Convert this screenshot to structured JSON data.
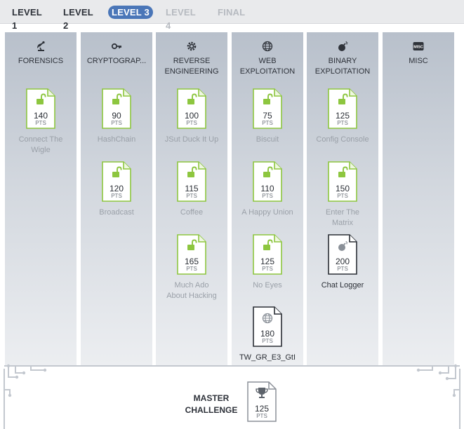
{
  "tabs": [
    {
      "label": "LEVEL 1",
      "state": "normal"
    },
    {
      "label": "LEVEL 2",
      "state": "normal"
    },
    {
      "label": "LEVEL 3",
      "state": "active"
    },
    {
      "label": "LEVEL 4",
      "state": "locked"
    },
    {
      "label": "FINAL",
      "state": "locked"
    }
  ],
  "colors": {
    "accent": "#4a76b8",
    "solved_green": "#8dc63f",
    "unlocked_outline": "#2a2e35",
    "column_top": "#b8c0cb"
  },
  "categories": [
    {
      "title": "FORENSICS",
      "icon": "satellite-dish-icon",
      "challenges": [
        {
          "name": "Connect The\nWigle",
          "points": "140",
          "unit": "PTS",
          "status": "solved"
        }
      ]
    },
    {
      "title": "CRYPTOGRAP...",
      "icon": "key-icon",
      "challenges": [
        {
          "name": "HashChain",
          "points": "90",
          "unit": "PTS",
          "status": "solved"
        },
        {
          "name": "Broadcast",
          "points": "120",
          "unit": "PTS",
          "status": "solved"
        }
      ]
    },
    {
      "title": "REVERSE\nENGINEERING",
      "icon": "gear-icon",
      "challenges": [
        {
          "name": "JSut Duck It Up",
          "points": "100",
          "unit": "PTS",
          "status": "solved"
        },
        {
          "name": "Coffee",
          "points": "115",
          "unit": "PTS",
          "status": "solved"
        },
        {
          "name": "Much Ado\nAbout Hacking",
          "points": "165",
          "unit": "PTS",
          "status": "solved"
        }
      ]
    },
    {
      "title": "WEB\nEXPLOITATION",
      "icon": "globe-icon",
      "challenges": [
        {
          "name": "Biscuit",
          "points": "75",
          "unit": "PTS",
          "status": "solved"
        },
        {
          "name": "A Happy Union",
          "points": "110",
          "unit": "PTS",
          "status": "solved"
        },
        {
          "name": "No Eyes",
          "points": "125",
          "unit": "PTS",
          "status": "solved"
        },
        {
          "name": "TW_GR_E3_GtI",
          "points": "180",
          "unit": "PTS",
          "status": "unlocked",
          "doc_icon": "globe-icon"
        }
      ]
    },
    {
      "title": "BINARY\nEXPLOITATION",
      "icon": "bomb-icon",
      "challenges": [
        {
          "name": "Config Console",
          "points": "125",
          "unit": "PTS",
          "status": "solved"
        },
        {
          "name": "Enter The\nMatrix",
          "points": "150",
          "unit": "PTS",
          "status": "solved"
        },
        {
          "name": "Chat Logger",
          "points": "200",
          "unit": "PTS",
          "status": "unlocked",
          "doc_icon": "bomb-icon"
        }
      ]
    },
    {
      "title": "MISC",
      "icon": "misc-icon",
      "icon_text": "MISC",
      "challenges": []
    }
  ],
  "master": {
    "label": "MASTER\nCHALLENGE",
    "points": "125",
    "unit": "PTS",
    "icon": "trophy-icon"
  }
}
